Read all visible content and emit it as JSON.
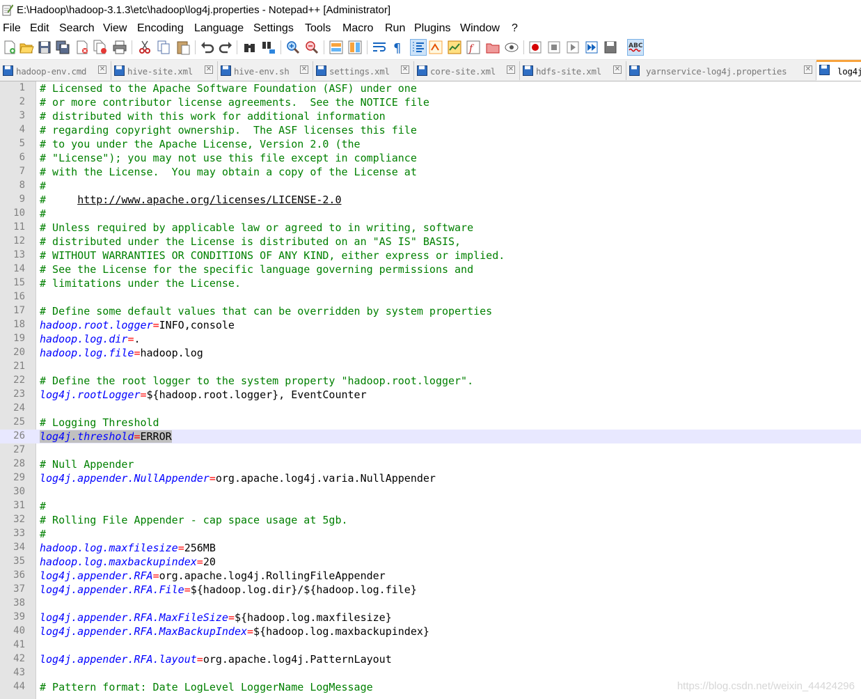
{
  "window": {
    "title": "E:\\Hadoop\\hadoop-3.1.3\\etc\\hadoop\\log4j.properties - Notepad++ [Administrator]"
  },
  "menu": [
    "File",
    "Edit",
    "Search",
    "View",
    "Encoding",
    "Language",
    "Settings",
    "Tools",
    "Macro",
    "Run",
    "Plugins",
    "Window",
    "?"
  ],
  "toolbar_icons": [
    "new-file-icon",
    "open-file-icon",
    "save-icon",
    "save-all-icon",
    "close-icon",
    "close-all-icon",
    "print-icon",
    "cut-icon",
    "copy-icon",
    "paste-icon",
    "undo-icon",
    "redo-icon",
    "find-icon",
    "replace-icon",
    "zoom-in-icon",
    "zoom-out-icon",
    "sync-vertical-icon",
    "sync-horizontal-icon",
    "word-wrap-icon",
    "show-all-characters-icon",
    "indent-guide-icon",
    "user-defined-language-icon",
    "doc-map-icon",
    "function-list-icon",
    "folder-workspace-icon",
    "monitoring-icon",
    "record-macro-icon",
    "stop-recording-icon",
    "playback-macro-icon",
    "run-macro-multiple-icon",
    "save-macro-icon",
    "spell-check-icon"
  ],
  "tabs": [
    {
      "label": "hadoop-env.cmd",
      "active": false
    },
    {
      "label": "hive-site.xml",
      "active": false
    },
    {
      "label": "hive-env.sh",
      "active": false
    },
    {
      "label": "settings.xml",
      "active": false
    },
    {
      "label": "core-site.xml",
      "active": false
    },
    {
      "label": "hdfs-site.xml",
      "active": false
    },
    {
      "label": "yarnservice-log4j.properties",
      "active": false
    },
    {
      "label": "log4j",
      "active": true
    }
  ],
  "editor": {
    "current_line": 26,
    "lines": [
      {
        "n": "1",
        "t": "comment",
        "text": "# Licensed to the Apache Software Foundation (ASF) under one"
      },
      {
        "n": "2",
        "t": "comment",
        "text": "# or more contributor license agreements.  See the NOTICE file"
      },
      {
        "n": "3",
        "t": "comment",
        "text": "# distributed with this work for additional information"
      },
      {
        "n": "4",
        "t": "comment",
        "text": "# regarding copyright ownership.  The ASF licenses this file"
      },
      {
        "n": "5",
        "t": "comment",
        "text": "# to you under the Apache License, Version 2.0 (the"
      },
      {
        "n": "6",
        "t": "comment",
        "text": "# \"License\"); you may not use this file except in compliance"
      },
      {
        "n": "7",
        "t": "comment",
        "text": "# with the License.  You may obtain a copy of the License at"
      },
      {
        "n": "8",
        "t": "comment",
        "text": "#"
      },
      {
        "n": "9",
        "t": "url",
        "text": "#     ",
        "url": "http://www.apache.org/licenses/LICENSE-2.0"
      },
      {
        "n": "10",
        "t": "comment",
        "text": "#"
      },
      {
        "n": "11",
        "t": "comment",
        "text": "# Unless required by applicable law or agreed to in writing, software"
      },
      {
        "n": "12",
        "t": "comment",
        "text": "# distributed under the License is distributed on an \"AS IS\" BASIS,"
      },
      {
        "n": "13",
        "t": "comment",
        "text": "# WITHOUT WARRANTIES OR CONDITIONS OF ANY KIND, either express or implied."
      },
      {
        "n": "14",
        "t": "comment",
        "text": "# See the License for the specific language governing permissions and"
      },
      {
        "n": "15",
        "t": "comment",
        "text": "# limitations under the License."
      },
      {
        "n": "16",
        "t": "blank",
        "text": ""
      },
      {
        "n": "17",
        "t": "comment",
        "text": "# Define some default values that can be overridden by system properties"
      },
      {
        "n": "18",
        "t": "kv",
        "key": "hadoop.root.logger",
        "value": "INFO,console"
      },
      {
        "n": "19",
        "t": "kv",
        "key": "hadoop.log.dir",
        "value": "."
      },
      {
        "n": "20",
        "t": "kv",
        "key": "hadoop.log.file",
        "value": "hadoop.log"
      },
      {
        "n": "21",
        "t": "blank",
        "text": ""
      },
      {
        "n": "22",
        "t": "comment",
        "text": "# Define the root logger to the system property \"hadoop.root.logger\"."
      },
      {
        "n": "23",
        "t": "kv",
        "key": "log4j.rootLogger",
        "value": "${hadoop.root.logger}, EventCounter"
      },
      {
        "n": "24",
        "t": "blank",
        "text": ""
      },
      {
        "n": "25",
        "t": "comment",
        "text": "# Logging Threshold"
      },
      {
        "n": "26",
        "t": "kv",
        "key": "log4j.threshold",
        "value": "ERROR",
        "selected": true
      },
      {
        "n": "27",
        "t": "blank",
        "text": ""
      },
      {
        "n": "28",
        "t": "comment",
        "text": "# Null Appender"
      },
      {
        "n": "29",
        "t": "kv",
        "key": "log4j.appender.NullAppender",
        "value": "org.apache.log4j.varia.NullAppender"
      },
      {
        "n": "30",
        "t": "blank",
        "text": ""
      },
      {
        "n": "31",
        "t": "comment",
        "text": "#"
      },
      {
        "n": "32",
        "t": "comment",
        "text": "# Rolling File Appender - cap space usage at 5gb."
      },
      {
        "n": "33",
        "t": "comment",
        "text": "#"
      },
      {
        "n": "34",
        "t": "kv",
        "key": "hadoop.log.maxfilesize",
        "value": "256MB"
      },
      {
        "n": "35",
        "t": "kv",
        "key": "hadoop.log.maxbackupindex",
        "value": "20"
      },
      {
        "n": "36",
        "t": "kv",
        "key": "log4j.appender.RFA",
        "value": "org.apache.log4j.RollingFileAppender"
      },
      {
        "n": "37",
        "t": "kv",
        "key": "log4j.appender.RFA.File",
        "value": "${hadoop.log.dir}/${hadoop.log.file}"
      },
      {
        "n": "38",
        "t": "blank",
        "text": ""
      },
      {
        "n": "39",
        "t": "kv",
        "key": "log4j.appender.RFA.MaxFileSize",
        "value": "${hadoop.log.maxfilesize}"
      },
      {
        "n": "40",
        "t": "kv",
        "key": "log4j.appender.RFA.MaxBackupIndex",
        "value": "${hadoop.log.maxbackupindex}"
      },
      {
        "n": "41",
        "t": "blank",
        "text": ""
      },
      {
        "n": "42",
        "t": "kv",
        "key": "log4j.appender.RFA.layout",
        "value": "org.apache.log4j.PatternLayout"
      },
      {
        "n": "43",
        "t": "blank",
        "text": ""
      },
      {
        "n": "44",
        "t": "comment",
        "text": "# Pattern format: Date LogLevel LoggerName LogMessage"
      }
    ]
  },
  "watermark": "https://blog.csdn.net/weixin_44424296",
  "colors": {
    "comment": "#008000",
    "key": "#0000ff",
    "operator": "#ff0000",
    "current_line": "#e8e8ff",
    "active_tab_accent": "#f8a33c"
  }
}
